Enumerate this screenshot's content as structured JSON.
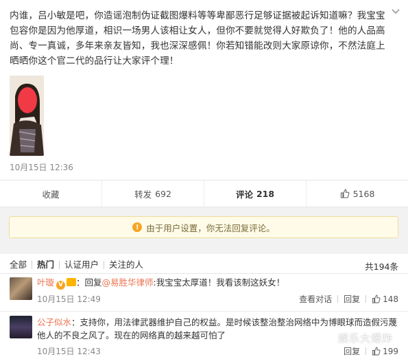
{
  "post": {
    "text": "内谁，吕小敏是吧，你造谣泡制伪证截图爆料等等卑鄙恶行足够证据被起诉知道嘛？我宝宝包容你是因为他厚道，相识一场男人该相让女人，但你不要就觉得人好欺负了！他的人品高尚、专一真诚，多年来亲友皆知，我也深深感佩！你若知错能改则大家原谅你，不然法庭上晒晒你这个官二代的品行让大家评个理！",
    "time": "10月15日 12:36",
    "menu_icon": "chevron-down-icon"
  },
  "actions": {
    "favorite": "收藏",
    "repost_label": "转发",
    "repost_count": "692",
    "comment_label": "评论",
    "comment_count": "218",
    "like_count": "5168"
  },
  "notice": {
    "text": "由于用户设置，你无法回复评论。",
    "icon": "warning-icon"
  },
  "comments_bar": {
    "tabs": [
      "全部",
      "热门",
      "认证用户",
      "关注的人"
    ],
    "active_tab": "热门",
    "total": "共194条"
  },
  "comments": [
    {
      "username": "叶璇",
      "badge": "V",
      "text_prefix": "：回复",
      "mention": "@易胜华律师",
      "text": ":我宝宝太厚道！我看该制这妖女！",
      "time": "10月15日 12:49",
      "view_dialog": "查看对话",
      "reply": "回复",
      "likes": "148"
    },
    {
      "username": "公子似水",
      "text": "：支持你，用法律武器维护自己的权益。是时候该整治整治网络中为博眼球而造假污蔑他人的不良之风了。现在的网络真的越来越可怕了",
      "time": "10月15日 12:43",
      "reply": "回复",
      "likes": "199"
    }
  ],
  "watermark": {
    "text": "娱乐大爆炸"
  },
  "colors": {
    "accent_orange": "#eb7350",
    "notice_bg": "#fffbe8",
    "notice_border": "#f0dc98",
    "warn": "#f5a623"
  }
}
